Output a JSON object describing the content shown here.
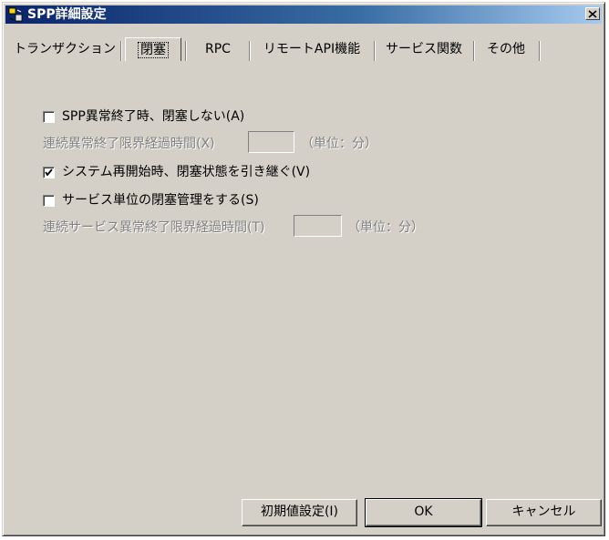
{
  "window": {
    "title": "SPP詳細設定",
    "close_label": "×"
  },
  "tabs": [
    {
      "label": "トランザクション"
    },
    {
      "label": "閉塞"
    },
    {
      "label": "RPC"
    },
    {
      "label": "リモートAPI機能"
    },
    {
      "label": "サービス関数"
    },
    {
      "label": "その他"
    }
  ],
  "active_tab": "閉塞",
  "options": {
    "no_block_on_abnormal": {
      "label": "SPP異常終了時、閉塞しない(A)",
      "checked": false
    },
    "consecutive_abnormal_interval": {
      "label": "連続異常終了限界経過時間(X)",
      "value": "",
      "unit": "（単位：分）"
    },
    "keep_block_on_restart": {
      "label": "システム再開始時、閉塞状態を引き継ぐ(V)",
      "checked": true
    },
    "service_unit_block": {
      "label": "サービス単位の閉塞管理をする(S)",
      "checked": false
    },
    "consecutive_service_interval": {
      "label": "連続サービス異常終了限界経過時間(T)",
      "value": "",
      "unit": "（単位：分）"
    }
  },
  "buttons": {
    "defaults": "初期値設定(I)",
    "ok": "OK",
    "cancel": "キャンセル"
  }
}
